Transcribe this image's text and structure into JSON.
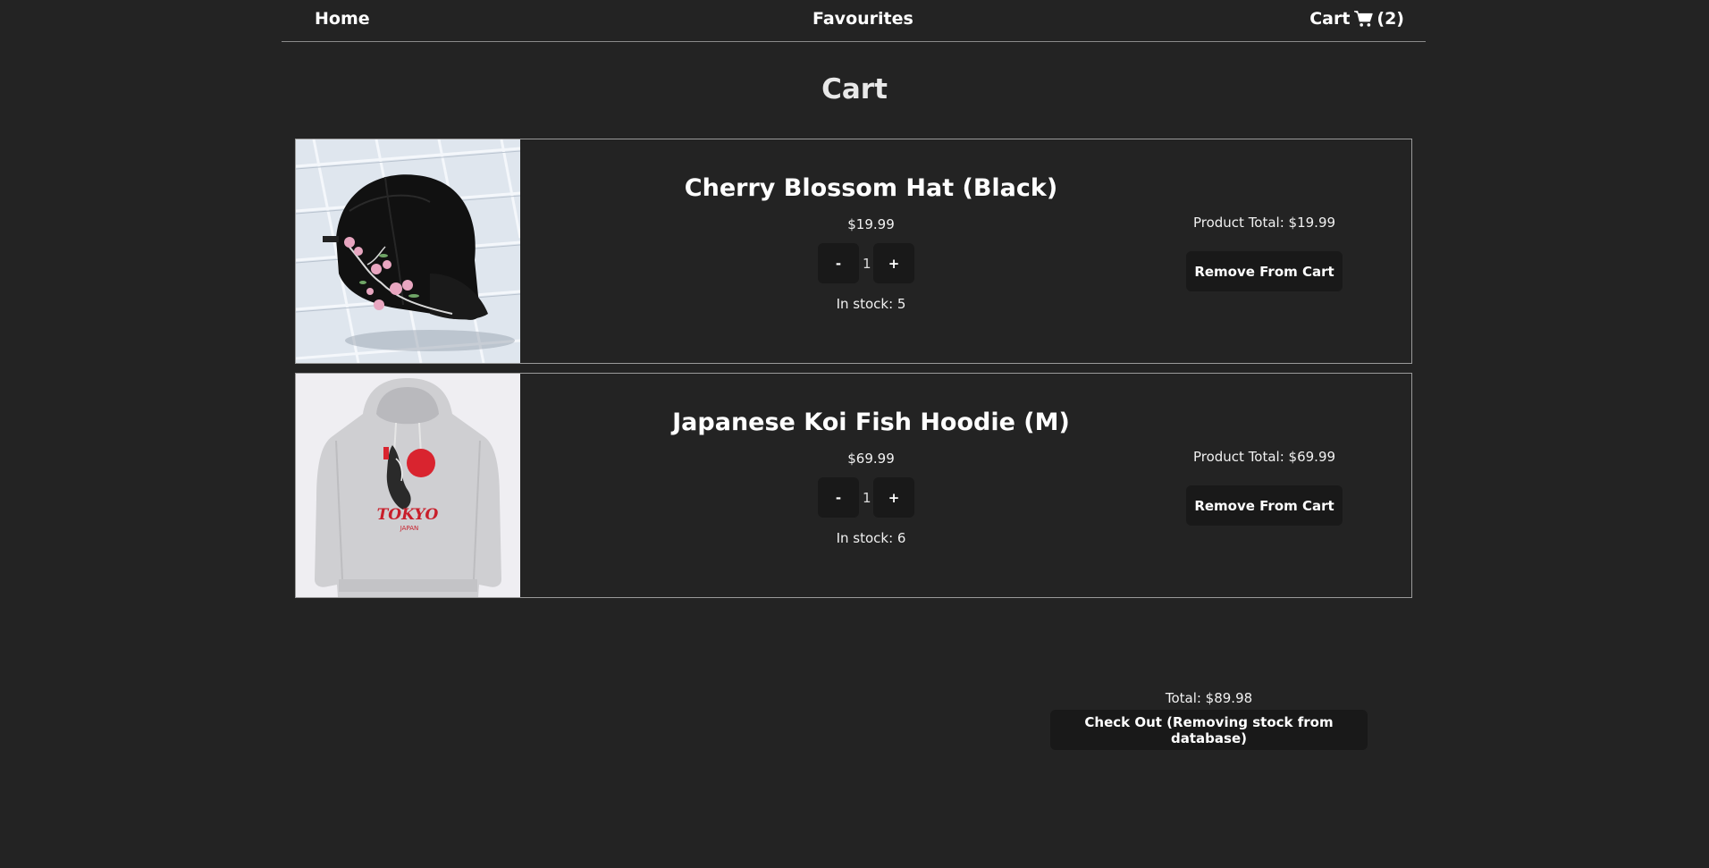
{
  "nav": {
    "home_label": "Home",
    "favourites_label": "Favourites",
    "cart_label": "Cart",
    "cart_count": "(2)",
    "cart_icon": "shopping-cart-icon"
  },
  "page": {
    "title": "Cart"
  },
  "items": [
    {
      "name": "Cherry Blossom Hat (Black)",
      "price": "$19.99",
      "qty_minus": "-",
      "qty": "1",
      "qty_plus": "+",
      "stock": "In stock: 5",
      "product_total": "Product Total: $19.99",
      "remove_label": "Remove From Cart",
      "image": "black-cap-with-cherry-blossom-embroidery"
    },
    {
      "name": "Japanese Koi Fish Hoodie (M)",
      "price": "$69.99",
      "qty_minus": "-",
      "qty": "1",
      "qty_plus": "+",
      "stock": "In stock: 6",
      "product_total": "Product Total: $69.99",
      "remove_label": "Remove From Cart",
      "image": "grey-hoodie-with-koi-fish-print"
    }
  ],
  "summary": {
    "total": "Total: $89.98",
    "checkout_label": "Check Out (Removing stock from database)"
  },
  "colors": {
    "background": "#232323",
    "button": "#191919",
    "border": "#9a9a9a",
    "text": "#ffffff"
  }
}
